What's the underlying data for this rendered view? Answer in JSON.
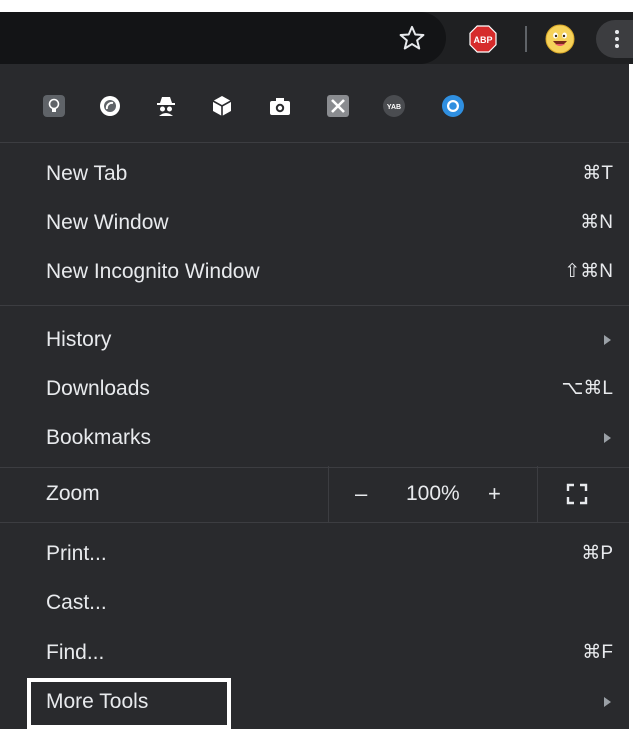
{
  "toolbar": {
    "icons": [
      "star-icon",
      "adblock-plus-icon",
      "profile-avatar-icon",
      "more-menu-icon"
    ],
    "abp_text": "ABP"
  },
  "extensions": {
    "icons": [
      "lightbulb-extension-icon",
      "circle-extension-icon",
      "incognito-spy-extension-icon",
      "cube-extension-icon",
      "camera-extension-icon",
      "x-extension-icon",
      "yab-extension-icon",
      "chrome-extension-icon"
    ],
    "yab_text": "YAB"
  },
  "menu": {
    "new_tab": {
      "label": "New Tab",
      "shortcut": "⌘T"
    },
    "new_window": {
      "label": "New Window",
      "shortcut": "⌘N"
    },
    "new_incognito": {
      "label": "New Incognito Window",
      "shortcut": "⇧⌘N"
    },
    "history": {
      "label": "History"
    },
    "downloads": {
      "label": "Downloads",
      "shortcut": "⌥⌘L"
    },
    "bookmarks": {
      "label": "Bookmarks"
    },
    "zoom": {
      "label": "Zoom",
      "minus": "–",
      "level": "100%",
      "plus": "+"
    },
    "print": {
      "label": "Print...",
      "shortcut": "⌘P"
    },
    "cast": {
      "label": "Cast..."
    },
    "find": {
      "label": "Find...",
      "shortcut": "⌘F"
    },
    "more_tools": {
      "label": "More Tools"
    }
  },
  "colors": {
    "menu_bg": "#292a2d",
    "text": "#e8eaed",
    "abp_red": "#d62b2b",
    "highlight_border": "#ffffff"
  }
}
